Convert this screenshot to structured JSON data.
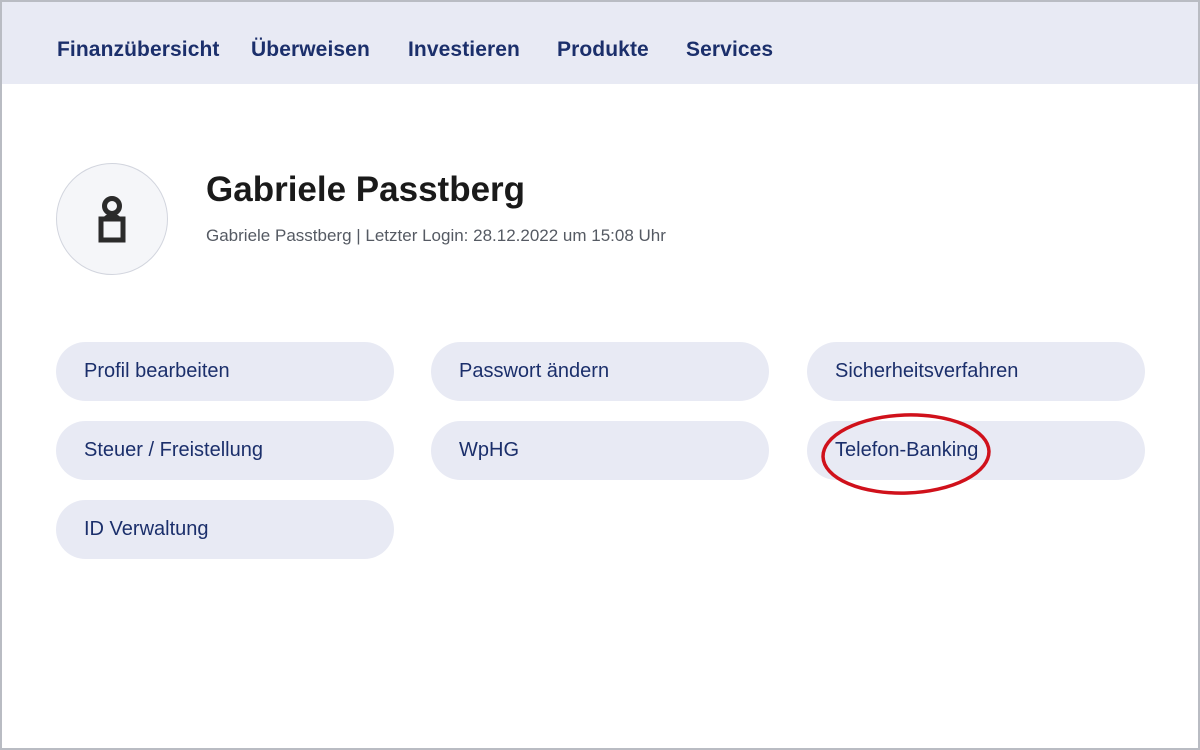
{
  "nav": {
    "items": [
      {
        "label": "Finanzübersicht"
      },
      {
        "label": "Überweisen"
      },
      {
        "label": "Investieren"
      },
      {
        "label": "Produkte"
      },
      {
        "label": "Services"
      }
    ]
  },
  "profile": {
    "avatar_icon": "user-icon",
    "name": "Gabriele Passtberg",
    "meta": "Gabriele Passtberg | Letzter Login: 28.12.2022 um 15:08 Uhr"
  },
  "settings": {
    "buttons": [
      {
        "label": "Profil bearbeiten"
      },
      {
        "label": "Passwort ändern"
      },
      {
        "label": "Sicherheitsverfahren"
      },
      {
        "label": "Steuer / Freistellung"
      },
      {
        "label": "WpHG"
      },
      {
        "label": "Telefon-Banking"
      },
      {
        "label": "ID Verwaltung"
      }
    ]
  },
  "annotation": {
    "shape": "ellipse",
    "color": "#d0111b",
    "target": "Telefon-Banking"
  },
  "colors": {
    "nav_background": "#e8eaf4",
    "nav_text": "#1b2f6b",
    "pill_background": "#e8eaf4",
    "highlight_ring": "#d0111b"
  }
}
